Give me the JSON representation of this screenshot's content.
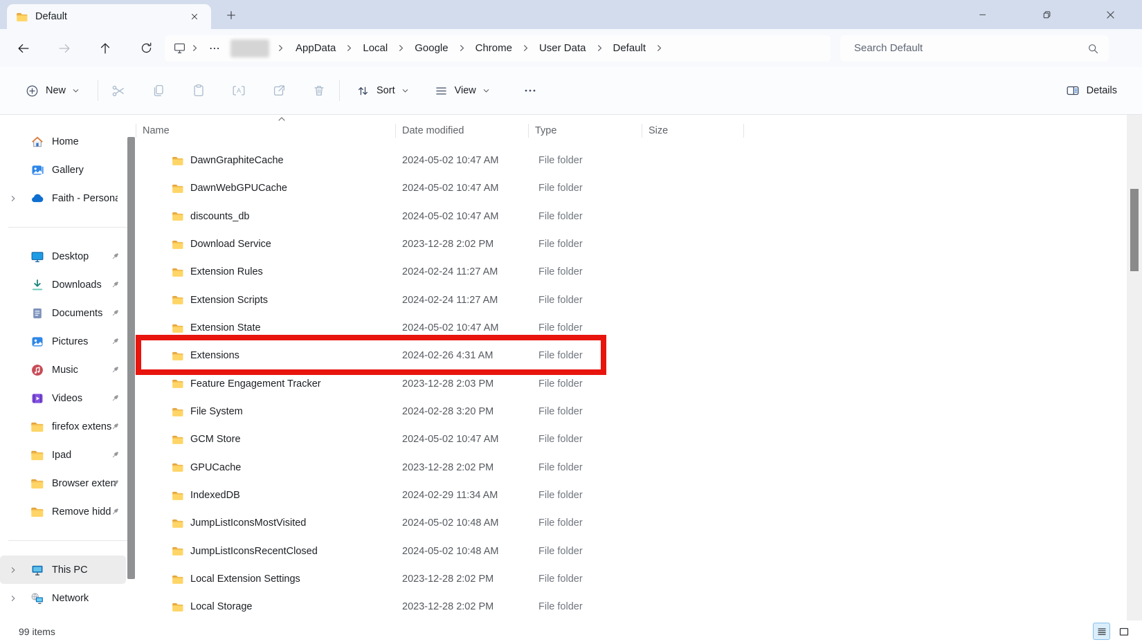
{
  "window": {
    "tab_title": "Default"
  },
  "addressbar": {
    "overflow_ellipsis": "⋯",
    "breadcrumb_segments": [
      {
        "label": "AppData"
      },
      {
        "label": "Local"
      },
      {
        "label": "Google"
      },
      {
        "label": "Chrome"
      },
      {
        "label": "User Data"
      },
      {
        "label": "Default"
      }
    ],
    "search_placeholder": "Search Default"
  },
  "toolbar": {
    "new_label": "New",
    "sort_label": "Sort",
    "view_label": "View",
    "details_label": "Details"
  },
  "sidebar": {
    "sections": [
      {
        "items": [
          {
            "label": "Home",
            "icon": "home"
          },
          {
            "label": "Gallery",
            "icon": "gallery"
          },
          {
            "label": "Faith - Personal",
            "icon": "onedrive",
            "expandable": true
          }
        ]
      },
      {
        "items": [
          {
            "label": "Desktop",
            "icon": "desktop",
            "pinned": true
          },
          {
            "label": "Downloads",
            "icon": "downloads",
            "pinned": true
          },
          {
            "label": "Documents",
            "icon": "documents",
            "pinned": true
          },
          {
            "label": "Pictures",
            "icon": "pictures",
            "pinned": true
          },
          {
            "label": "Music",
            "icon": "music",
            "pinned": true
          },
          {
            "label": "Videos",
            "icon": "videos",
            "pinned": true
          },
          {
            "label": "firefox extens",
            "icon": "folder",
            "pinned": true
          },
          {
            "label": "Ipad",
            "icon": "folder",
            "pinned": true
          },
          {
            "label": "Browser exten",
            "icon": "folder",
            "pinned": true
          },
          {
            "label": "Remove hidd",
            "icon": "folder",
            "pinned": true
          }
        ]
      },
      {
        "items": [
          {
            "label": "This PC",
            "icon": "thispc",
            "expandable": true,
            "selected": true
          },
          {
            "label": "Network",
            "icon": "network",
            "expandable": true
          }
        ]
      }
    ]
  },
  "files": {
    "columns": [
      {
        "label": "Name"
      },
      {
        "label": "Date modified"
      },
      {
        "label": "Type"
      },
      {
        "label": "Size"
      }
    ],
    "sort": {
      "column": "Name",
      "direction": "ascending"
    },
    "rows": [
      {
        "name": "DawnGraphiteCache",
        "date_modified": "2024-05-02 10:47 AM",
        "type": "File folder",
        "size": ""
      },
      {
        "name": "DawnWebGPUCache",
        "date_modified": "2024-05-02 10:47 AM",
        "type": "File folder",
        "size": ""
      },
      {
        "name": "discounts_db",
        "date_modified": "2024-05-02 10:47 AM",
        "type": "File folder",
        "size": ""
      },
      {
        "name": "Download Service",
        "date_modified": "2023-12-28 2:02 PM",
        "type": "File folder",
        "size": ""
      },
      {
        "name": "Extension Rules",
        "date_modified": "2024-02-24 11:27 AM",
        "type": "File folder",
        "size": ""
      },
      {
        "name": "Extension Scripts",
        "date_modified": "2024-02-24 11:27 AM",
        "type": "File folder",
        "size": ""
      },
      {
        "name": "Extension State",
        "date_modified": "2024-05-02 10:47 AM",
        "type": "File folder",
        "size": ""
      },
      {
        "name": "Extensions",
        "date_modified": "2024-02-26 4:31 AM",
        "type": "File folder",
        "size": "",
        "highlighted": true
      },
      {
        "name": "Feature Engagement Tracker",
        "date_modified": "2023-12-28 2:03 PM",
        "type": "File folder",
        "size": ""
      },
      {
        "name": "File System",
        "date_modified": "2024-02-28 3:20 PM",
        "type": "File folder",
        "size": ""
      },
      {
        "name": "GCM Store",
        "date_modified": "2024-05-02 10:47 AM",
        "type": "File folder",
        "size": ""
      },
      {
        "name": "GPUCache",
        "date_modified": "2023-12-28 2:02 PM",
        "type": "File folder",
        "size": ""
      },
      {
        "name": "IndexedDB",
        "date_modified": "2024-02-29 11:34 AM",
        "type": "File folder",
        "size": ""
      },
      {
        "name": "JumpListIconsMostVisited",
        "date_modified": "2024-05-02 10:48 AM",
        "type": "File folder",
        "size": ""
      },
      {
        "name": "JumpListIconsRecentClosed",
        "date_modified": "2024-05-02 10:48 AM",
        "type": "File folder",
        "size": ""
      },
      {
        "name": "Local Extension Settings",
        "date_modified": "2023-12-28 2:02 PM",
        "type": "File folder",
        "size": ""
      },
      {
        "name": "Local Storage",
        "date_modified": "2023-12-28 2:02 PM",
        "type": "File folder",
        "size": ""
      }
    ]
  },
  "statusbar": {
    "items_count": "99 items"
  },
  "annotation": {
    "type": "highlight-box",
    "color": "#e8140e",
    "target": "Extensions row"
  },
  "colors": {
    "titlebar": "#d3dcec",
    "accent_blue": "#2f7bd9",
    "folder_yellow": "#ffd567",
    "annotation_red": "#e8140e",
    "selected_sidebar": "#ececec"
  }
}
